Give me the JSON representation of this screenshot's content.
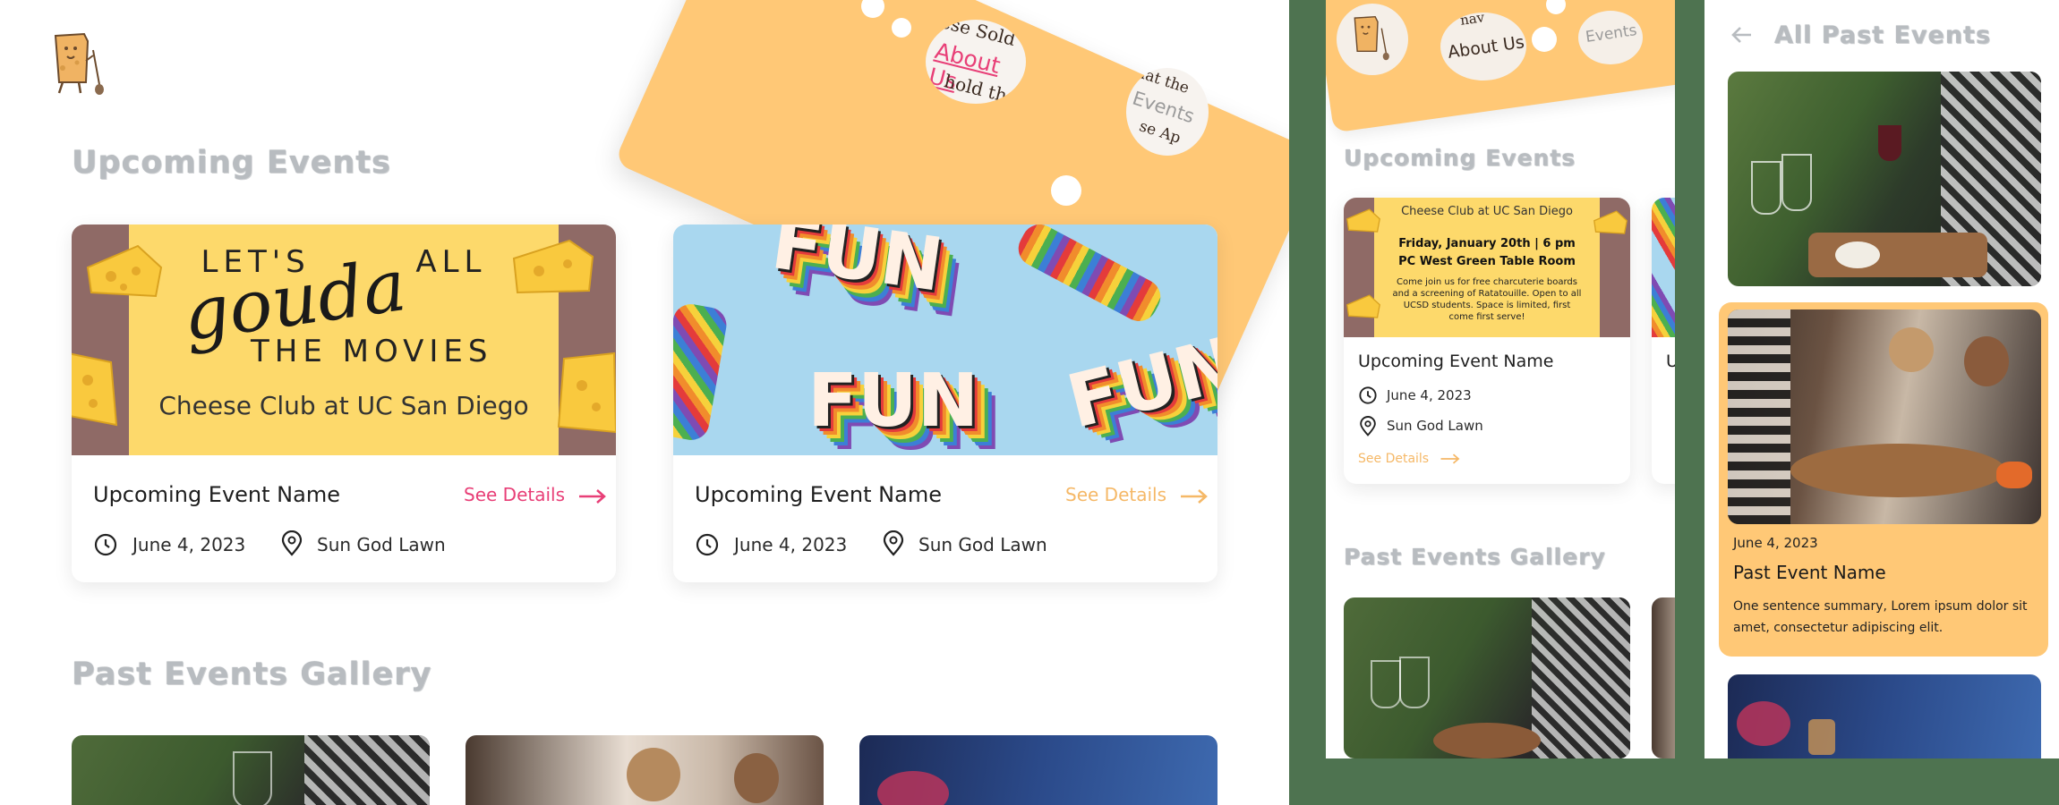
{
  "desktop": {
    "nav": {
      "about_label": "About Us",
      "events_label": "Events",
      "frag_top": "ese Sold",
      "frag_mid": "hold the",
      "frag_right_top": "hat the",
      "frag_right_bot": "se Ap"
    },
    "upcoming_title": "Upcoming Events",
    "past_title": "Past Events Gallery",
    "events": [
      {
        "name": "Upcoming Event Name",
        "date": "June 4, 2023",
        "location": "Sun God Lawn",
        "cta": "See Details",
        "cta_color": "#e83f77"
      },
      {
        "name": "Upcoming Event Name",
        "date": "June 4, 2023",
        "location": "Sun God Lawn",
        "cta": "See Details",
        "cta_color": "#f5b867"
      }
    ],
    "poster": {
      "line1": "LET'S",
      "line1b": "ALL",
      "script": "gouda",
      "line3": "THE MOVIES",
      "club": "Cheese Club at UC San Diego"
    },
    "fun_word": "FUN"
  },
  "mobile": {
    "nav": {
      "about_label": "About Us",
      "events_label": "Events",
      "frag": "nav"
    },
    "upcoming_title": "Upcoming Events",
    "past_title": "Past Events Gallery",
    "event": {
      "name": "Upcoming Event Name",
      "date": "June 4, 2023",
      "location": "Sun God Lawn",
      "cta": "See Details",
      "cta_color": "#f5b867",
      "poster": {
        "club": "Cheese Club at UC San Diego",
        "when": "Friday, January 20th | 6 pm",
        "where": "PC West Green Table Room",
        "body": "Come join us for free charcuterie boards and a screening of Ratatouille. Open to all UCSD students. Space is limited, first come first serve!"
      }
    },
    "peek_event_initial": "U"
  },
  "past_page": {
    "title": "All Past Events",
    "featured": {
      "date": "June 4, 2023",
      "name": "Past Event Name",
      "summary": "One sentence summary, Lorem ipsum dolor sit amet, consectetur adipiscing elit."
    }
  },
  "colors": {
    "accent_pink": "#e83f77",
    "accent_orange": "#f5b867",
    "ticket": "#ffc876",
    "frame_green": "#4e7350",
    "title_grey": "#b8bcc0"
  }
}
